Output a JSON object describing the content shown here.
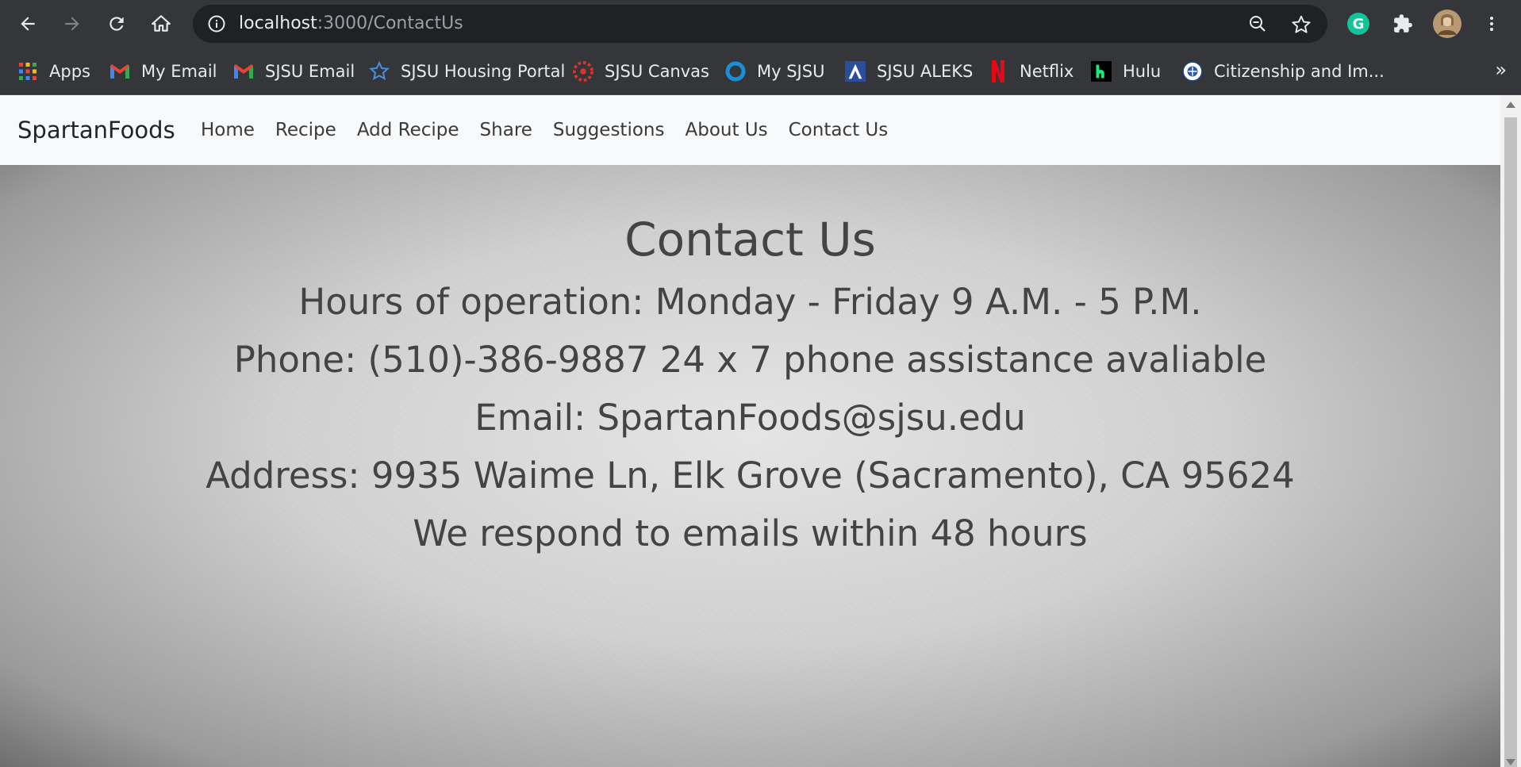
{
  "browser": {
    "url_host": "localhost",
    "url_path": ":3000/ContactUs",
    "bookmarks": [
      {
        "label": "Apps",
        "icon": "apps-grid-icon"
      },
      {
        "label": "My Email",
        "icon": "gmail-icon"
      },
      {
        "label": "SJSU Email",
        "icon": "gmail-icon"
      },
      {
        "label": "SJSU Housing Portal",
        "icon": "star-icon"
      },
      {
        "label": "SJSU Canvas",
        "icon": "canvas-icon"
      },
      {
        "label": "My SJSU",
        "icon": "circle-icon"
      },
      {
        "label": "SJSU ALEKS",
        "icon": "aleks-icon"
      },
      {
        "label": "Netflix",
        "icon": "netflix-icon"
      },
      {
        "label": "Hulu",
        "icon": "hulu-icon"
      },
      {
        "label": "Citizenship and Im...",
        "icon": "seal-icon"
      }
    ],
    "more_bookmarks": "»"
  },
  "site": {
    "brand": "SpartanFoods",
    "nav": [
      "Home",
      "Recipe",
      "Add Recipe",
      "Share",
      "Suggestions",
      "About Us",
      "Contact Us"
    ]
  },
  "contact": {
    "title": "Contact Us",
    "hours": "Hours of operation: Monday - Friday 9 A.M. - 5 P.M.",
    "phone": "Phone: (510)-386-9887 24 x 7 phone assistance avaliable",
    "email": "Email: SpartanFoods@sjsu.edu",
    "address": "Address: 9935 Waime Ln, Elk Grove (Sacramento), CA 95624",
    "response": "We respond to emails within 48 hours"
  },
  "colors": {
    "toolbar": "#35363a",
    "omnibox": "#202124",
    "navbar": "#f8f9fa",
    "text": "#444444"
  }
}
